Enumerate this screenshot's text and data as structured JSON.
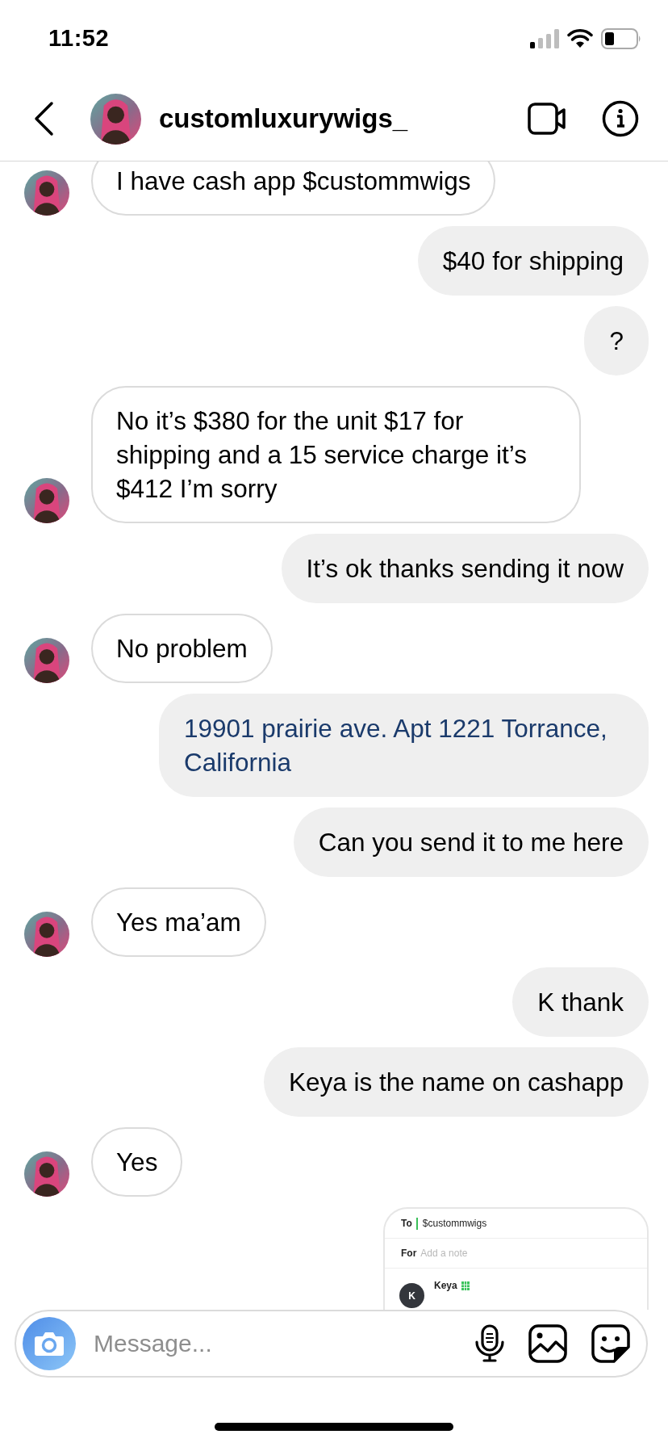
{
  "status_bar": {
    "time": "11:52"
  },
  "header": {
    "username": "customluxurywigs_"
  },
  "messages": [
    {
      "kind": "incoming",
      "text": "I have cash app $custommwigs"
    },
    {
      "kind": "outgoing",
      "text": "$40 for shipping"
    },
    {
      "kind": "outgoing",
      "text": "?"
    },
    {
      "kind": "incoming",
      "text": "No it’s $380 for the unit $17 for shipping and a 15 service charge it’s $412 I’m sorry"
    },
    {
      "kind": "outgoing",
      "text": "It’s ok thanks sending it now"
    },
    {
      "kind": "incoming",
      "text": "No problem"
    },
    {
      "kind": "outgoing_link",
      "text": "19901 prairie ave. Apt 1221 Torrance, California"
    },
    {
      "kind": "outgoing",
      "text": "Can you send it to me here"
    },
    {
      "kind": "incoming",
      "text": "Yes ma’am"
    },
    {
      "kind": "outgoing",
      "text": "K thank"
    },
    {
      "kind": "outgoing",
      "text": "Keya is the name on cashapp"
    },
    {
      "kind": "incoming",
      "text": "Yes"
    },
    {
      "kind": "outgoing_screenshot",
      "to_label": "To",
      "to_value": "$custommwigs",
      "for_label": "For",
      "note_placeholder": "Add a note",
      "contact_initial": "K",
      "contact_name": "Keya"
    }
  ],
  "composer": {
    "placeholder": "Message..."
  }
}
